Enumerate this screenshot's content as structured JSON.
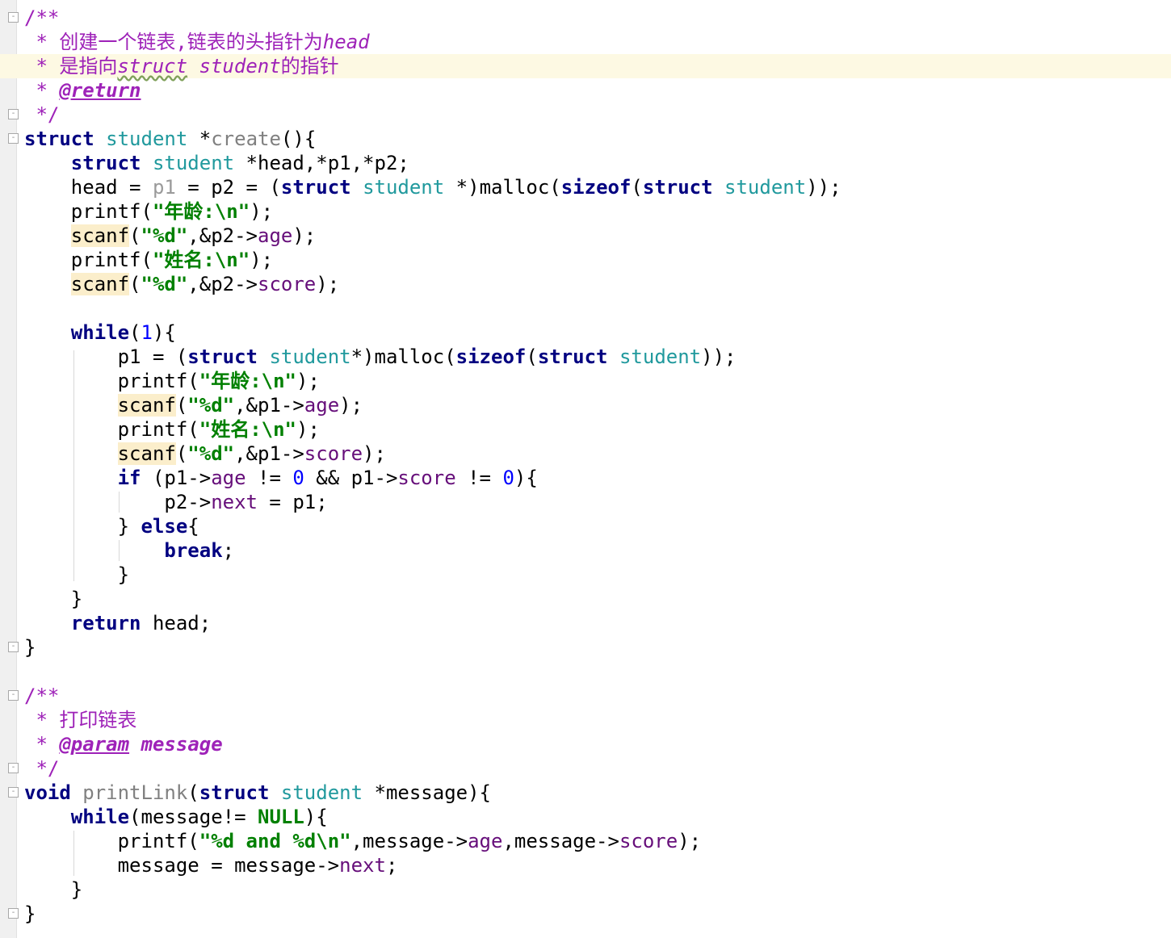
{
  "editor": {
    "language": "C",
    "theme_colors": {
      "keyword": "#000080",
      "type": "#20999d",
      "string": "#008000",
      "number": "#0000ff",
      "field": "#660e7a",
      "comment": "#9e22b8",
      "current_line": "#fdf9e3"
    },
    "lines": [
      [
        {
          "t": "/**",
          "c": "cm"
        }
      ],
      [
        {
          "t": " * 创建一个链表,链表的头指针为",
          "c": "cm"
        },
        {
          "t": "head",
          "c": "cm-em"
        }
      ],
      [
        {
          "t": " * 是指向",
          "c": "cm"
        },
        {
          "t": "struct",
          "c": "cm-em squiggle"
        },
        {
          "t": " ",
          "c": "cm"
        },
        {
          "t": "student",
          "c": "cm-em"
        },
        {
          "t": "的指针",
          "c": "cm"
        }
      ],
      [
        {
          "t": " * ",
          "c": "cm"
        },
        {
          "t": "@return",
          "c": "tag"
        }
      ],
      [
        {
          "t": " */",
          "c": "cm"
        }
      ],
      [
        {
          "t": "struct",
          "c": "kw"
        },
        {
          "t": " ",
          "c": "plain"
        },
        {
          "t": "student",
          "c": "ty"
        },
        {
          "t": " *",
          "c": "plain"
        },
        {
          "t": "create",
          "c": "fn-decl"
        },
        {
          "t": "(){",
          "c": "plain"
        }
      ],
      [
        {
          "t": "    ",
          "c": "plain"
        },
        {
          "t": "struct",
          "c": "kw"
        },
        {
          "t": " ",
          "c": "plain"
        },
        {
          "t": "student",
          "c": "ty"
        },
        {
          "t": " *head,*p1,*p2;",
          "c": "plain"
        }
      ],
      [
        {
          "t": "    head = ",
          "c": "plain"
        },
        {
          "t": "p1",
          "c": "unused"
        },
        {
          "t": " = p2 = (",
          "c": "plain"
        },
        {
          "t": "struct",
          "c": "kw"
        },
        {
          "t": " ",
          "c": "plain"
        },
        {
          "t": "student",
          "c": "ty"
        },
        {
          "t": " *)malloc(",
          "c": "plain"
        },
        {
          "t": "sizeof",
          "c": "kw"
        },
        {
          "t": "(",
          "c": "plain"
        },
        {
          "t": "struct",
          "c": "kw"
        },
        {
          "t": " ",
          "c": "plain"
        },
        {
          "t": "student",
          "c": "ty"
        },
        {
          "t": "));",
          "c": "plain"
        }
      ],
      [
        {
          "t": "    printf(",
          "c": "plain"
        },
        {
          "t": "\"年龄:\\n\"",
          "c": "str"
        },
        {
          "t": ");",
          "c": "plain"
        }
      ],
      [
        {
          "t": "    ",
          "c": "plain"
        },
        {
          "t": "scanf",
          "c": "warn"
        },
        {
          "t": "(",
          "c": "plain"
        },
        {
          "t": "\"%d\"",
          "c": "str"
        },
        {
          "t": ",&p2->",
          "c": "plain"
        },
        {
          "t": "age",
          "c": "fld"
        },
        {
          "t": ");",
          "c": "plain"
        }
      ],
      [
        {
          "t": "    printf(",
          "c": "plain"
        },
        {
          "t": "\"姓名:\\n\"",
          "c": "str"
        },
        {
          "t": ");",
          "c": "plain"
        }
      ],
      [
        {
          "t": "    ",
          "c": "plain"
        },
        {
          "t": "scanf",
          "c": "warn"
        },
        {
          "t": "(",
          "c": "plain"
        },
        {
          "t": "\"%d\"",
          "c": "str"
        },
        {
          "t": ",&p2->",
          "c": "plain"
        },
        {
          "t": "score",
          "c": "fld"
        },
        {
          "t": ");",
          "c": "plain"
        }
      ],
      [],
      [
        {
          "t": "    ",
          "c": "plain"
        },
        {
          "t": "while",
          "c": "kw"
        },
        {
          "t": "(",
          "c": "plain"
        },
        {
          "t": "1",
          "c": "num"
        },
        {
          "t": "){",
          "c": "plain"
        }
      ],
      [
        {
          "t": "        p1 = (",
          "c": "plain"
        },
        {
          "t": "struct",
          "c": "kw"
        },
        {
          "t": " ",
          "c": "plain"
        },
        {
          "t": "student",
          "c": "ty"
        },
        {
          "t": "*)malloc(",
          "c": "plain"
        },
        {
          "t": "sizeof",
          "c": "kw"
        },
        {
          "t": "(",
          "c": "plain"
        },
        {
          "t": "struct",
          "c": "kw"
        },
        {
          "t": " ",
          "c": "plain"
        },
        {
          "t": "student",
          "c": "ty"
        },
        {
          "t": "));",
          "c": "plain"
        }
      ],
      [
        {
          "t": "        printf(",
          "c": "plain"
        },
        {
          "t": "\"年龄:\\n\"",
          "c": "str"
        },
        {
          "t": ");",
          "c": "plain"
        }
      ],
      [
        {
          "t": "        ",
          "c": "plain"
        },
        {
          "t": "scanf",
          "c": "warn"
        },
        {
          "t": "(",
          "c": "plain"
        },
        {
          "t": "\"%d\"",
          "c": "str"
        },
        {
          "t": ",&p1->",
          "c": "plain"
        },
        {
          "t": "age",
          "c": "fld"
        },
        {
          "t": ");",
          "c": "plain"
        }
      ],
      [
        {
          "t": "        printf(",
          "c": "plain"
        },
        {
          "t": "\"姓名:\\n\"",
          "c": "str"
        },
        {
          "t": ");",
          "c": "plain"
        }
      ],
      [
        {
          "t": "        ",
          "c": "plain"
        },
        {
          "t": "scanf",
          "c": "warn"
        },
        {
          "t": "(",
          "c": "plain"
        },
        {
          "t": "\"%d\"",
          "c": "str"
        },
        {
          "t": ",&p1->",
          "c": "plain"
        },
        {
          "t": "score",
          "c": "fld"
        },
        {
          "t": ");",
          "c": "plain"
        }
      ],
      [
        {
          "t": "        ",
          "c": "plain"
        },
        {
          "t": "if",
          "c": "kw"
        },
        {
          "t": " (p1->",
          "c": "plain"
        },
        {
          "t": "age",
          "c": "fld"
        },
        {
          "t": " != ",
          "c": "plain"
        },
        {
          "t": "0",
          "c": "num"
        },
        {
          "t": " && p1->",
          "c": "plain"
        },
        {
          "t": "score",
          "c": "fld"
        },
        {
          "t": " != ",
          "c": "plain"
        },
        {
          "t": "0",
          "c": "num"
        },
        {
          "t": "){",
          "c": "plain"
        }
      ],
      [
        {
          "t": "            p2->",
          "c": "plain"
        },
        {
          "t": "next",
          "c": "fld"
        },
        {
          "t": " = p1;",
          "c": "plain"
        }
      ],
      [
        {
          "t": "        } ",
          "c": "plain"
        },
        {
          "t": "else",
          "c": "kw"
        },
        {
          "t": "{",
          "c": "plain"
        }
      ],
      [
        {
          "t": "            ",
          "c": "plain"
        },
        {
          "t": "break",
          "c": "kw"
        },
        {
          "t": ";",
          "c": "plain"
        }
      ],
      [
        {
          "t": "        }",
          "c": "plain"
        }
      ],
      [
        {
          "t": "    }",
          "c": "plain"
        }
      ],
      [
        {
          "t": "    ",
          "c": "plain"
        },
        {
          "t": "return",
          "c": "kw"
        },
        {
          "t": " head;",
          "c": "plain"
        }
      ],
      [
        {
          "t": "}",
          "c": "plain"
        }
      ],
      [],
      [
        {
          "t": "/**",
          "c": "cm"
        }
      ],
      [
        {
          "t": " * 打印链表",
          "c": "cm"
        }
      ],
      [
        {
          "t": " * ",
          "c": "cm"
        },
        {
          "t": "@param",
          "c": "tag"
        },
        {
          "t": " ",
          "c": "cm"
        },
        {
          "t": "message",
          "c": "tagval"
        }
      ],
      [
        {
          "t": " */",
          "c": "cm"
        }
      ],
      [
        {
          "t": "void",
          "c": "kw"
        },
        {
          "t": " ",
          "c": "plain"
        },
        {
          "t": "printLink",
          "c": "fn-decl"
        },
        {
          "t": "(",
          "c": "plain"
        },
        {
          "t": "struct",
          "c": "kw"
        },
        {
          "t": " ",
          "c": "plain"
        },
        {
          "t": "student",
          "c": "ty"
        },
        {
          "t": " *message){",
          "c": "plain"
        }
      ],
      [
        {
          "t": "    ",
          "c": "plain"
        },
        {
          "t": "while",
          "c": "kw"
        },
        {
          "t": "(message!= ",
          "c": "plain"
        },
        {
          "t": "NULL",
          "c": "str"
        },
        {
          "t": "){",
          "c": "plain"
        }
      ],
      [
        {
          "t": "        printf(",
          "c": "plain"
        },
        {
          "t": "\"%d and %d\\n\"",
          "c": "str"
        },
        {
          "t": ",message->",
          "c": "plain"
        },
        {
          "t": "age",
          "c": "fld"
        },
        {
          "t": ",message->",
          "c": "plain"
        },
        {
          "t": "score",
          "c": "fld"
        },
        {
          "t": ");",
          "c": "plain"
        }
      ],
      [
        {
          "t": "        message = message->",
          "c": "plain"
        },
        {
          "t": "next",
          "c": "fld"
        },
        {
          "t": ";",
          "c": "plain"
        }
      ],
      [
        {
          "t": "    }",
          "c": "plain"
        }
      ],
      [
        {
          "t": "}",
          "c": "plain"
        }
      ]
    ]
  }
}
